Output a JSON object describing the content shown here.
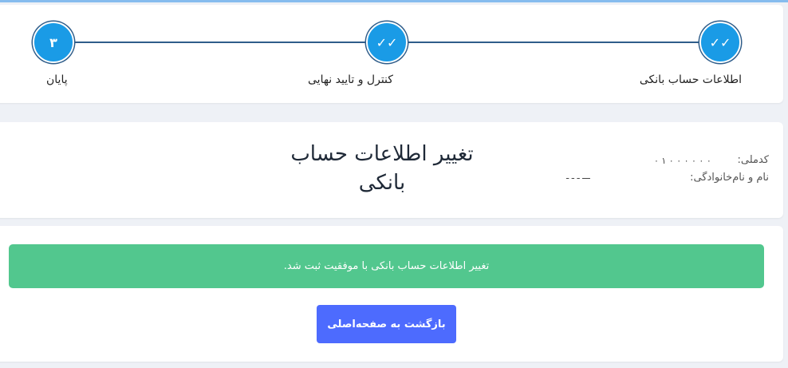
{
  "stepper": {
    "steps": [
      {
        "label": "اطلاعات حساب بانکی",
        "icon": "double-check-icon",
        "mark": "✓✓",
        "state": "completed"
      },
      {
        "label": "کنترل و تایید نهایی",
        "icon": "double-check-icon",
        "mark": "✓✓",
        "state": "completed"
      },
      {
        "label": "پایان",
        "icon": "number",
        "mark": "۳",
        "state": "current"
      }
    ]
  },
  "info": {
    "title": "تغییر اطلاعات حساب بانکی",
    "national_code_label": "کدملی:",
    "national_code_value": "۰ ۱ ۰ ۰ ۰ ۰ ۰ ۰",
    "fullname_label": "نام و نام‌خانوادگی:",
    "fullname_value": "ـــ ـ ـ ـ"
  },
  "result": {
    "message": "تغییر اطلاعات حساب بانکی با موفقیت ثبت شد.",
    "home_button_label": "بازگشت به صفحه‌اصلی"
  },
  "colors": {
    "accent": "#1a9be6",
    "success": "#52c78e",
    "primary_button": "#4d6bfe"
  }
}
